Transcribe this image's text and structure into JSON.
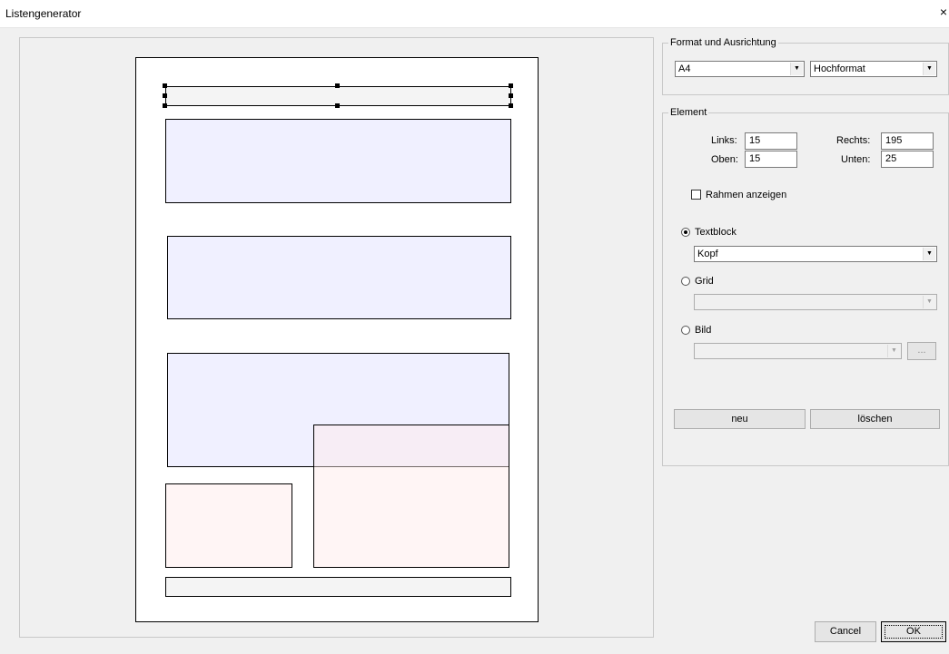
{
  "window": {
    "title": "Listengenerator",
    "close_glyph": "×"
  },
  "format": {
    "legend": "Format und Ausrichtung",
    "paper_size": "A4",
    "orientation": "Hochformat"
  },
  "element": {
    "legend": "Element",
    "links_label": "Links:",
    "links_value": "15",
    "rechts_label": "Rechts:",
    "rechts_value": "195",
    "oben_label": "Oben:",
    "oben_value": "15",
    "unten_label": "Unten:",
    "unten_value": "25",
    "rahmen_label": "Rahmen anzeigen",
    "rahmen_checked": false,
    "textblock_label": "Textblock",
    "textblock_value": "Kopf",
    "grid_label": "Grid",
    "grid_value": "",
    "bild_label": "Bild",
    "bild_value": "",
    "browse_label": "...",
    "selected_type": "Textblock"
  },
  "buttons": {
    "neu": "neu",
    "loeschen": "löschen",
    "cancel": "Cancel",
    "ok": "OK"
  },
  "icons": {
    "dropdown": "dropdown-arrow-icon",
    "close": "close-icon"
  }
}
